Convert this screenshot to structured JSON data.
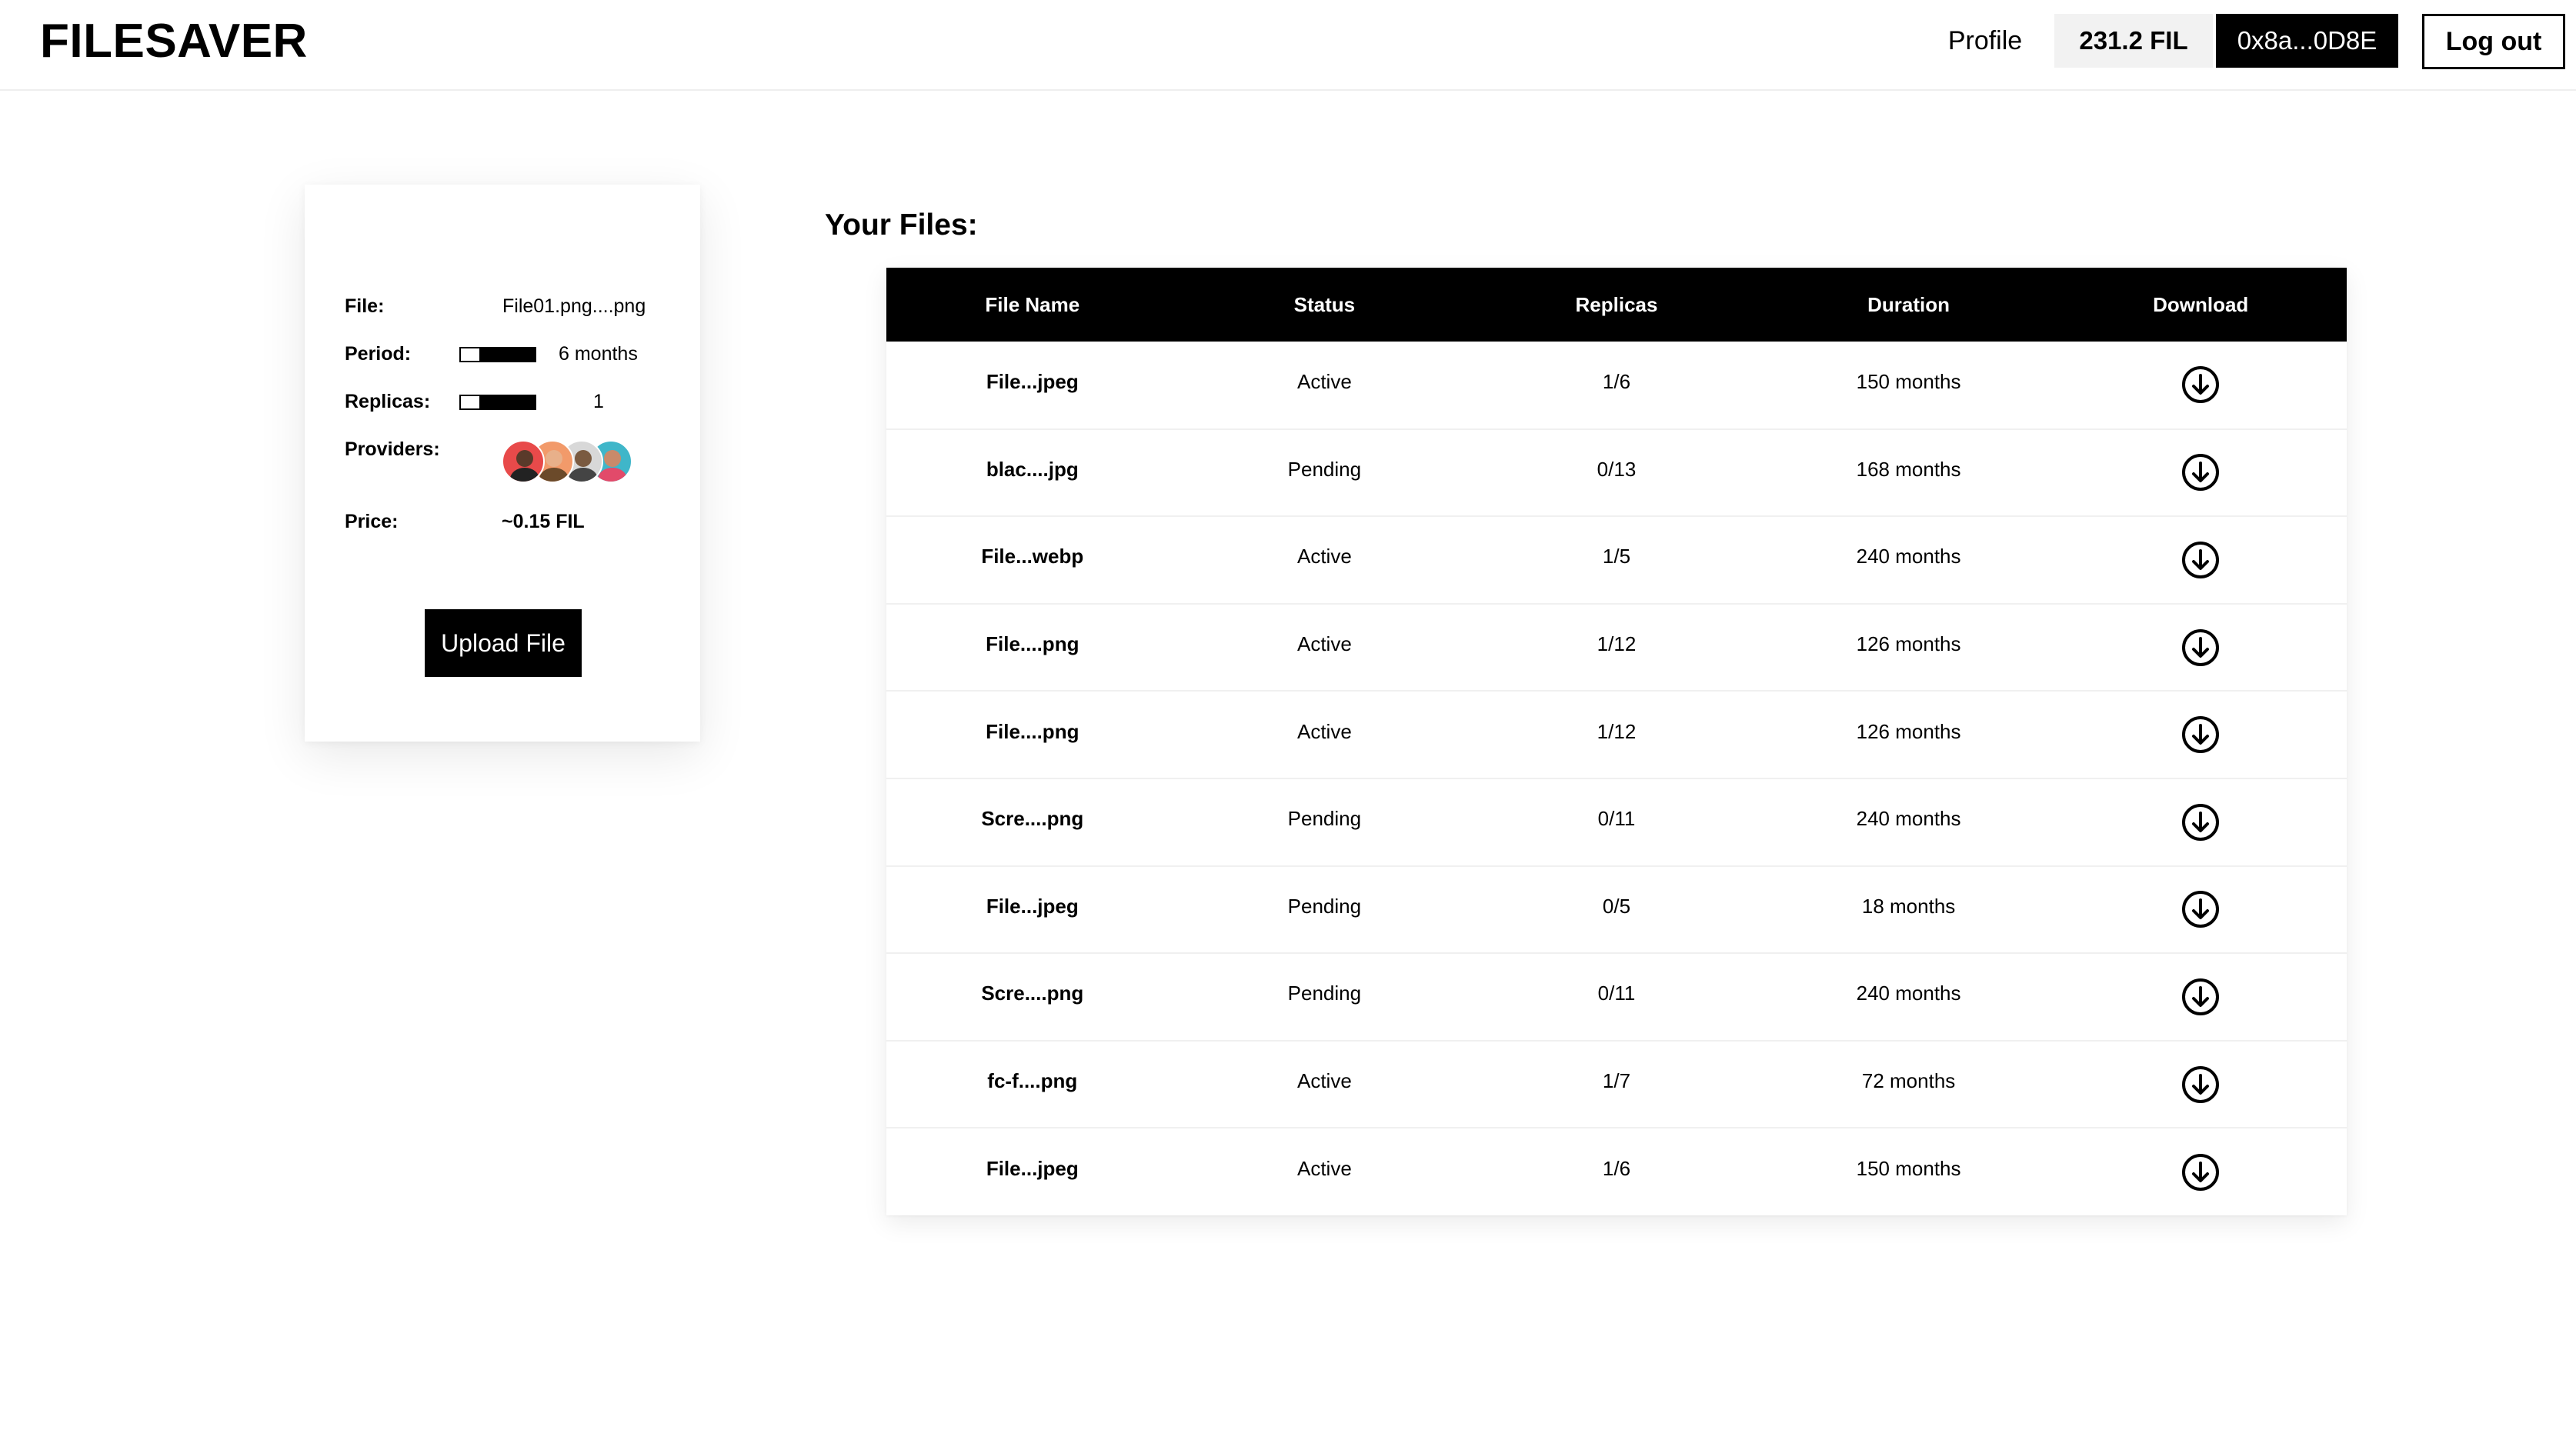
{
  "header": {
    "logo": "FILESAVER",
    "profile_label": "Profile",
    "balance": "231.2 FIL",
    "wallet": "0x8a...0D8E",
    "logout_label": "Log out"
  },
  "upload_card": {
    "file_label": "File:",
    "file_value": "File01.png....png",
    "period_label": "Period:",
    "period_value": "6 months",
    "replicas_label": "Replicas:",
    "replicas_value": "1",
    "providers_label": "Providers:",
    "providers": [
      {
        "name": "provider-avatar",
        "bg": "#e84a4a",
        "skin": "#5a3a2a",
        "shirt": "#222222"
      },
      {
        "name": "provider-avatar",
        "bg": "#f29a6a",
        "skin": "#e8b08a",
        "shirt": "#6b4a2a"
      },
      {
        "name": "provider-avatar",
        "bg": "#d8d8d8",
        "skin": "#7a5a40",
        "shirt": "#444444"
      },
      {
        "name": "provider-avatar",
        "bg": "#3fb6c9",
        "skin": "#c98a6a",
        "shirt": "#e24a6a"
      }
    ],
    "price_label": "Price:",
    "price_value": "~0.15 FIL",
    "upload_button": "Upload File"
  },
  "files": {
    "title": "Your Files:",
    "columns": [
      "File Name",
      "Status",
      "Replicas",
      "Duration",
      "Download"
    ],
    "rows": [
      {
        "name": "File...jpeg",
        "status": "Active",
        "replicas": "1/6",
        "duration": "150 months"
      },
      {
        "name": "blac....jpg",
        "status": "Pending",
        "replicas": "0/13",
        "duration": "168 months"
      },
      {
        "name": "File...webp",
        "status": "Active",
        "replicas": "1/5",
        "duration": "240 months"
      },
      {
        "name": "File....png",
        "status": "Active",
        "replicas": "1/12",
        "duration": "126 months"
      },
      {
        "name": "File....png",
        "status": "Active",
        "replicas": "1/12",
        "duration": "126 months"
      },
      {
        "name": "Scre....png",
        "status": "Pending",
        "replicas": "0/11",
        "duration": "240 months"
      },
      {
        "name": "File...jpeg",
        "status": "Pending",
        "replicas": "0/5",
        "duration": "18 months"
      },
      {
        "name": "Scre....png",
        "status": "Pending",
        "replicas": "0/11",
        "duration": "240 months"
      },
      {
        "name": "fc-f....png",
        "status": "Active",
        "replicas": "1/7",
        "duration": "72 months"
      },
      {
        "name": "File...jpeg",
        "status": "Active",
        "replicas": "1/6",
        "duration": "150 months"
      }
    ],
    "download_icon": "download-arrow-circle-icon"
  }
}
